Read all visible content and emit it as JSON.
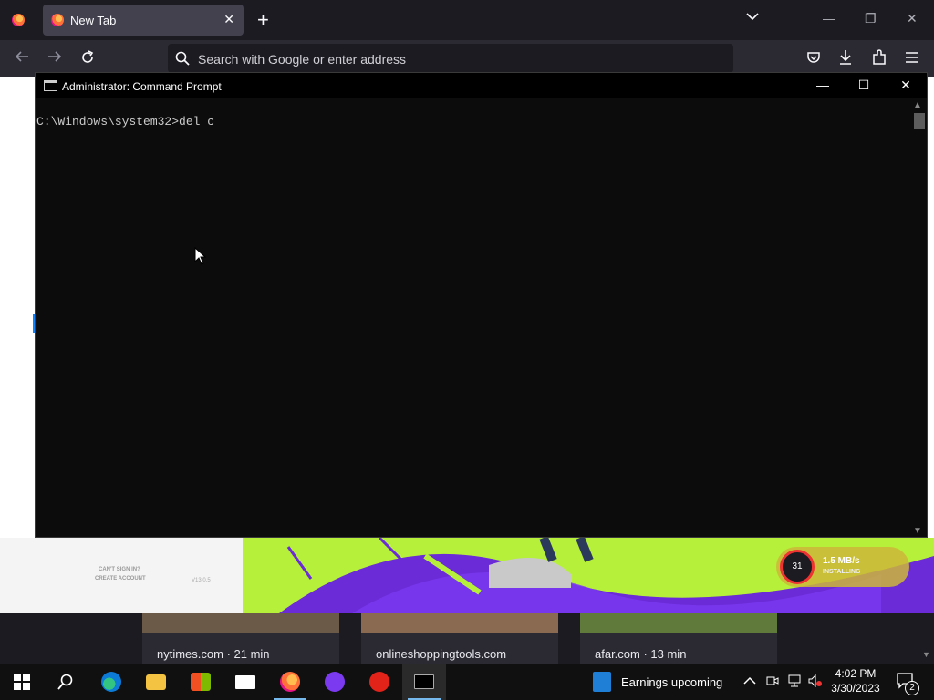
{
  "browser": {
    "tab_title": "New Tab",
    "tab_close": "✕",
    "new_tab": "+",
    "url_placeholder": "Search with Google or enter address"
  },
  "cmd": {
    "title": "Administrator: Command Prompt",
    "prompt_line": "C:\\Windows\\system32>del c",
    "min": "—",
    "max": "☐",
    "close": "✕"
  },
  "newtab": {
    "cant_sign_in": "CAN'T SIGN IN?",
    "create_account": "CREATE ACCOUNT",
    "version": "V13.0.5",
    "speed": "1.5 MB/s",
    "status": "INSTALLING",
    "progress_num": "31",
    "cards": [
      {
        "label": "nytimes.com · 21 min"
      },
      {
        "label": "onlineshoppingtools.com"
      },
      {
        "label": "afar.com · 13 min"
      }
    ]
  },
  "taskbar": {
    "news": "Earnings upcoming",
    "time": "4:02 PM",
    "date": "3/30/2023",
    "notif_count": "2"
  },
  "colors": {
    "accent_lime": "#b6f03a",
    "purple": "#6b2bd6",
    "taskbar": "#101010"
  }
}
